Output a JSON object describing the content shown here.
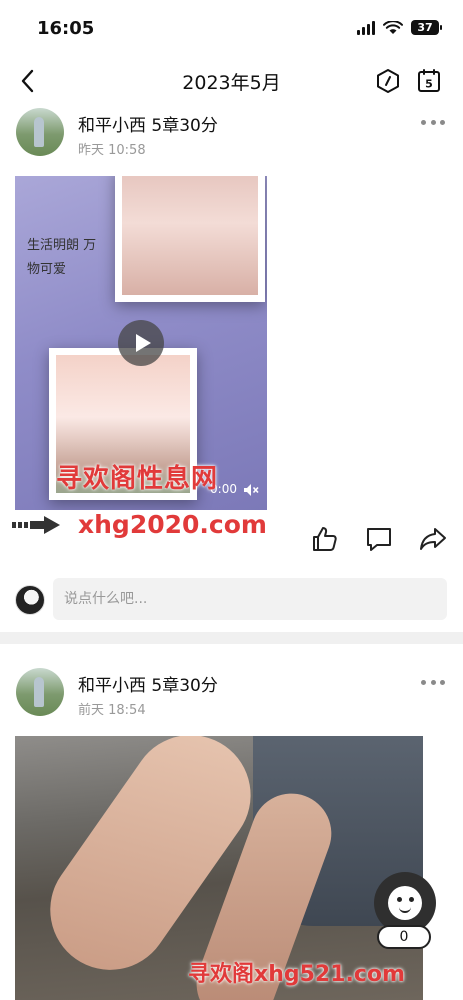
{
  "status": {
    "time": "16:05",
    "battery": "37"
  },
  "nav": {
    "title": "2023年5月"
  },
  "posts": [
    {
      "author": "和平小西 5章30分",
      "time": "昨天 10:58",
      "media_type": "video",
      "duration": "0:00",
      "doodle_text": "生活明朗 万物可爱"
    },
    {
      "author": "和平小西 5章30分",
      "time": "前天 18:54",
      "media_type": "photo"
    }
  ],
  "comment": {
    "placeholder": "说点什么吧..."
  },
  "fab": {
    "count": "0"
  },
  "watermarks": {
    "site_name": "寻欢阁性息网",
    "url": "xhg2020.com",
    "bottom": "寻欢阁xhg521.com"
  },
  "icons": [
    "back-icon",
    "hexagon-icon",
    "calendar-icon",
    "more-icon",
    "play-icon",
    "mute-icon",
    "like-icon",
    "comment-icon",
    "share-icon",
    "assistant-face-icon"
  ],
  "colors": {
    "watermark": "#e13a3a",
    "separator": "#f0f0f0",
    "input_bg": "#f2f2f2",
    "fab_bg": "#2f2f2f"
  }
}
